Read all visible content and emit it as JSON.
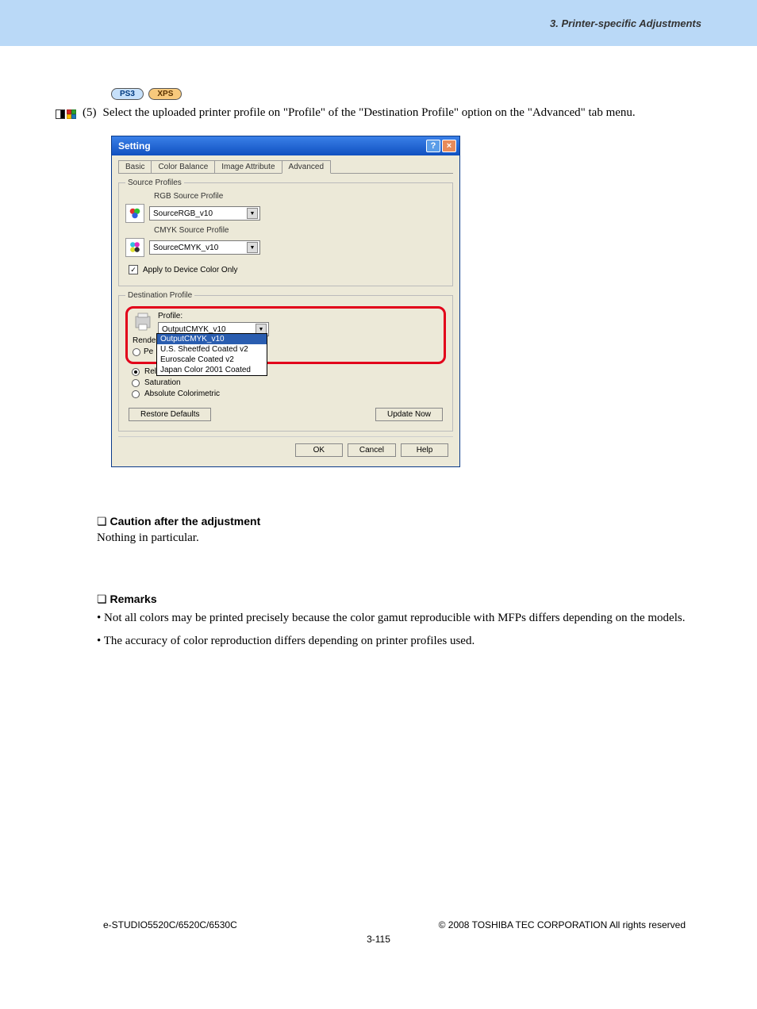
{
  "header": {
    "chapter": "3. Printer-specific Adjustments"
  },
  "badges": {
    "ps3": "PS3",
    "xps": "XPS"
  },
  "step": {
    "num": "(5)",
    "text": "Select the uploaded printer profile on \"Profile\" of the \"Destination Profile\" option on the \"Advanced\" tab menu."
  },
  "dialog": {
    "title": "Setting",
    "tabs": [
      "Basic",
      "Color Balance",
      "Image Attribute",
      "Advanced"
    ],
    "source_profiles": {
      "legend": "Source Profiles",
      "rgb_label": "RGB Source Profile",
      "rgb_value": "SourceRGB_v10",
      "cmyk_label": "CMYK Source Profile",
      "cmyk_value": "SourceCMYK_v10"
    },
    "apply_checkbox": "Apply to Device Color Only",
    "dest_profile": {
      "legend": "Destination Profile",
      "profile_label": "Profile:",
      "profile_value": "OutputCMYK_v10",
      "dropdown_opts": [
        "OutputCMYK_v10",
        "U.S. Sheetfed Coated v2",
        "Euroscale Coated v2",
        "Japan Color 2001 Coated"
      ],
      "rendering_label": "Renderi",
      "pe_label": "Pe",
      "radios": [
        "Relative Colorimetric",
        "Saturation",
        "Absolute Colorimetric"
      ]
    },
    "restore_btn": "Restore Defaults",
    "update_btn": "Update Now",
    "ok": "OK",
    "cancel": "Cancel",
    "help": "Help"
  },
  "caution": {
    "head": "Caution after the adjustment",
    "body": "Nothing in particular."
  },
  "remarks": {
    "head": "Remarks",
    "items": [
      "Not all colors may be printed precisely because the color gamut reproducible with MFPs differs depending on the models.",
      "The accuracy of color reproduction differs depending on printer profiles used."
    ]
  },
  "footer": {
    "left": "e-STUDIO5520C/6520C/6530C",
    "right": "© 2008 TOSHIBA TEC CORPORATION All rights reserved",
    "page": "3-115"
  }
}
